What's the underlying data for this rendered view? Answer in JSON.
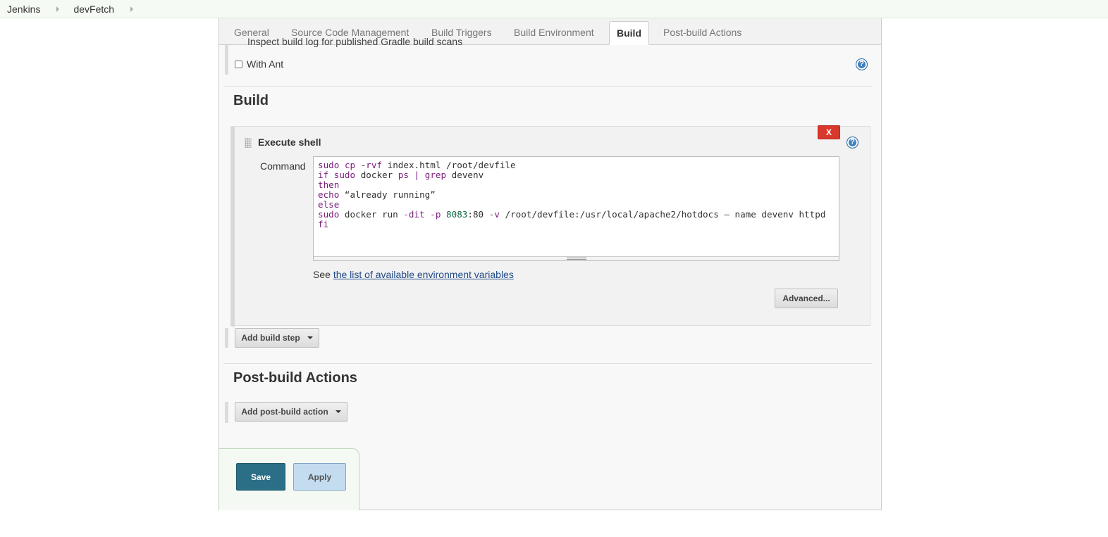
{
  "breadcrumb": {
    "items": [
      "Jenkins",
      "devFetch"
    ]
  },
  "tabs": [
    {
      "label": "General",
      "active": false
    },
    {
      "label": "Source Code Management",
      "active": false
    },
    {
      "label": "Build Triggers",
      "active": false
    },
    {
      "label": "Build Environment",
      "active": false
    },
    {
      "label": "Build",
      "active": true
    },
    {
      "label": "Post-build Actions",
      "active": false
    }
  ],
  "build_environment": {
    "partial_option_label": "Inspect build log for published Gradle build scans",
    "with_ant": {
      "label": "With Ant",
      "checked": false
    }
  },
  "build": {
    "section_title": "Build",
    "step": {
      "title": "Execute shell",
      "delete_label": "X",
      "command_label": "Command",
      "command_lines": [
        "sudo cp -rvf index.html /root/devfile",
        "if sudo docker ps | grep devenv",
        "then",
        "echo “already running”",
        "else",
        "sudo docker run -dit -p 8083:80 -v /root/devfile:/usr/local/apache2/hotdocs — name devenv httpd",
        "fi"
      ],
      "env_prefix": "See ",
      "env_link": "the list of available environment variables",
      "advanced_label": "Advanced..."
    },
    "add_step_label": "Add build step"
  },
  "post_build": {
    "section_title": "Post-build Actions",
    "add_action_label": "Add post-build action"
  },
  "footer": {
    "save_label": "Save",
    "apply_label": "Apply"
  },
  "icons": {
    "help": "help-icon",
    "drag": "drag-handle-icon",
    "dropdown": "chevron-down-icon",
    "breadcrumb_separator": "chevron-right-icon"
  },
  "colors": {
    "save_button": "#2b6f86",
    "apply_button": "#c4dcef",
    "delete_button": "#d9382c",
    "help_icon": "#3f7fbf"
  }
}
